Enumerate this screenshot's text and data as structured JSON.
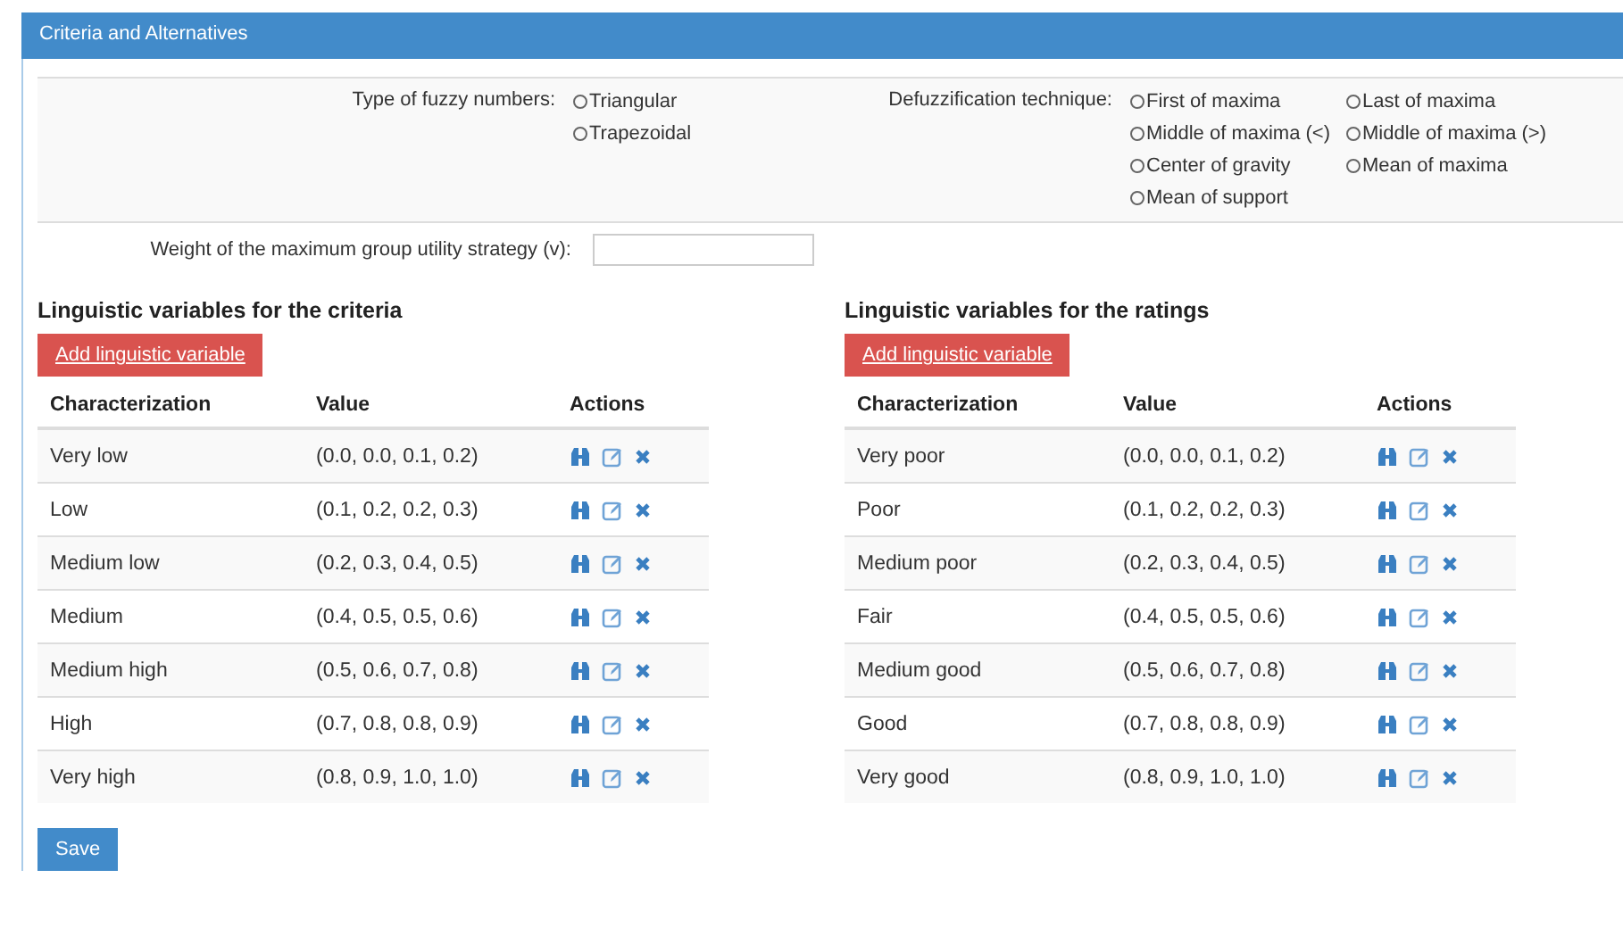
{
  "panel": {
    "title": "Criteria and Alternatives"
  },
  "fuzzy_type": {
    "label": "Type of fuzzy numbers:",
    "options": [
      {
        "label": "Triangular",
        "selected": false
      },
      {
        "label": "Trapezoidal",
        "selected": false
      }
    ]
  },
  "defuzzification": {
    "label": "Defuzzification technique:",
    "options": [
      {
        "label": "First of maxima",
        "selected": false
      },
      {
        "label": "Last of maxima",
        "selected": false
      },
      {
        "label": "Middle of maxima (<)",
        "selected": false
      },
      {
        "label": "Middle of maxima (>)",
        "selected": false
      },
      {
        "label": "Center of gravity",
        "selected": false
      },
      {
        "label": "Mean of maxima",
        "selected": false
      },
      {
        "label": "Mean of support",
        "selected": false
      }
    ]
  },
  "weight": {
    "label": "Weight of the maximum group utility strategy (v):"
  },
  "tables": [
    {
      "title": "Linguistic variables for the criteria",
      "add_button": "Add linguistic variable",
      "columns": [
        "Characterization",
        "Value",
        "Actions"
      ],
      "rows": [
        {
          "name": "Very low",
          "value": "(0.0, 0.0, 0.1, 0.2)"
        },
        {
          "name": "Low",
          "value": "(0.1, 0.2, 0.2, 0.3)"
        },
        {
          "name": "Medium low",
          "value": "(0.2, 0.3, 0.4, 0.5)"
        },
        {
          "name": "Medium",
          "value": "(0.4, 0.5, 0.5, 0.6)"
        },
        {
          "name": "Medium high",
          "value": "(0.5, 0.6, 0.7, 0.8)"
        },
        {
          "name": "High",
          "value": "(0.7, 0.8, 0.8, 0.9)"
        },
        {
          "name": "Very high",
          "value": "(0.8, 0.9, 1.0, 1.0)"
        }
      ]
    },
    {
      "title": "Linguistic variables for the ratings",
      "add_button": "Add linguistic variable",
      "columns": [
        "Characterization",
        "Value",
        "Actions"
      ],
      "rows": [
        {
          "name": "Very poor",
          "value": "(0.0, 0.0, 0.1, 0.2)"
        },
        {
          "name": "Poor",
          "value": "(0.1, 0.2, 0.2, 0.3)"
        },
        {
          "name": "Medium poor",
          "value": "(0.2, 0.3, 0.4, 0.5)"
        },
        {
          "name": "Fair",
          "value": "(0.4, 0.5, 0.5, 0.6)"
        },
        {
          "name": "Medium good",
          "value": "(0.5, 0.6, 0.7, 0.8)"
        },
        {
          "name": "Good",
          "value": "(0.7, 0.8, 0.8, 0.9)"
        },
        {
          "name": "Very good",
          "value": "(0.8, 0.9, 1.0, 1.0)"
        }
      ]
    }
  ],
  "save_button": "Save"
}
